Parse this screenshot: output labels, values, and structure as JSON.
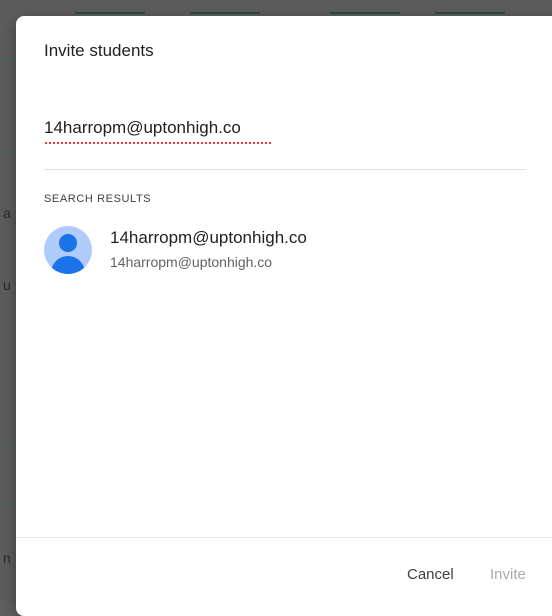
{
  "dialog": {
    "title": "Invite students",
    "search_value": "14harropm@uptonhigh.co",
    "section_label": "SEARCH RESULTS",
    "results": [
      {
        "name": "14harropm@uptonhigh.co",
        "email": "14harropm@uptonhigh.co",
        "avatar_icon": "person-icon"
      }
    ],
    "cancel_label": "Cancel",
    "invite_label": "Invite",
    "invite_enabled": false
  },
  "background": {
    "letters": [
      "a",
      "u",
      "n"
    ]
  },
  "colors": {
    "accent": "#1a73e8",
    "avatar_bg": "#aecbfa",
    "disabled_text": "#aaaaaa",
    "spellcheck": "#e53935"
  }
}
